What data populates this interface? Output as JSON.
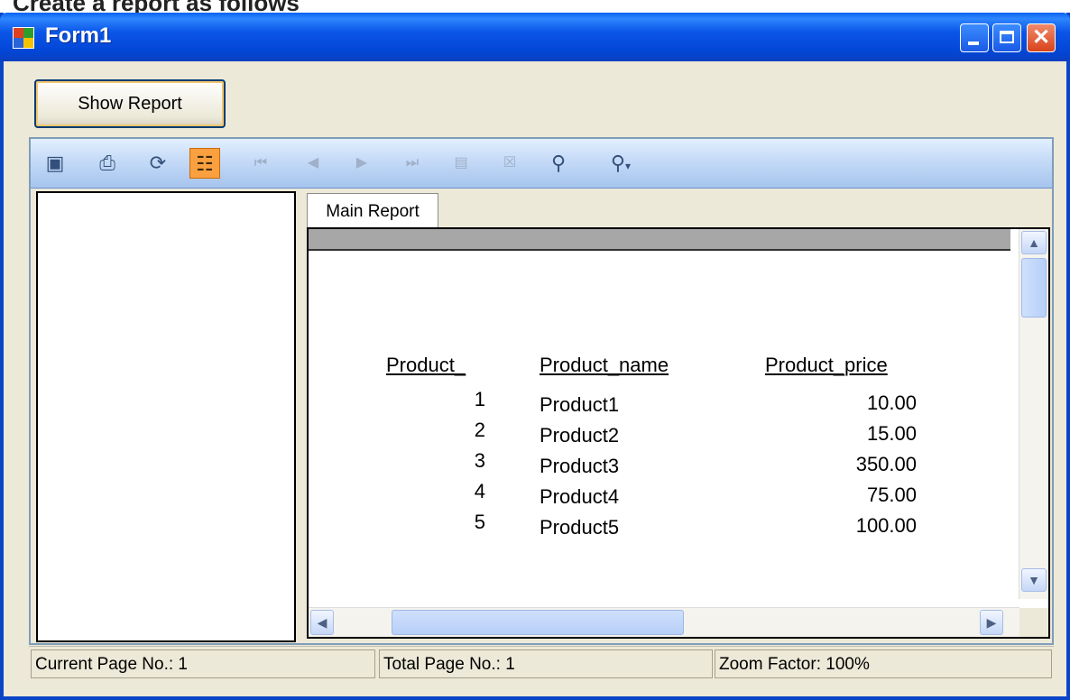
{
  "window": {
    "title": "Form1"
  },
  "partial_caption": "Create a report as follows",
  "show_report_button": "Show Report",
  "toolbar": {
    "buttons": [
      {
        "icon": "export-icon",
        "enabled": true
      },
      {
        "icon": "print-icon",
        "enabled": true
      },
      {
        "icon": "refresh-icon",
        "enabled": true
      },
      {
        "icon": "toggle-group-tree-icon",
        "enabled": true,
        "active": true
      },
      {
        "icon": "first-page-icon",
        "enabled": false
      },
      {
        "icon": "previous-page-icon",
        "enabled": false
      },
      {
        "icon": "next-page-icon",
        "enabled": false
      },
      {
        "icon": "last-page-icon",
        "enabled": false
      },
      {
        "icon": "goto-page-icon",
        "enabled": false
      },
      {
        "icon": "close-current-view-icon",
        "enabled": false
      },
      {
        "icon": "find-text-icon",
        "enabled": true
      },
      {
        "icon": "zoom-icon",
        "enabled": true
      }
    ]
  },
  "tab": {
    "label": "Main Report"
  },
  "report": {
    "headers": [
      "Product_",
      "Product_name",
      "Product_price"
    ],
    "rows": [
      {
        "id": "1",
        "name": "Product1",
        "price": "10.00"
      },
      {
        "id": "2",
        "name": "Product2",
        "price": "15.00"
      },
      {
        "id": "3",
        "name": "Product3",
        "price": "350.00"
      },
      {
        "id": "4",
        "name": "Product4",
        "price": "75.00"
      },
      {
        "id": "5",
        "name": "Product5",
        "price": "100.00"
      }
    ]
  },
  "status": {
    "current_page": "Current Page No.: 1",
    "total_page": "Total Page No.: 1",
    "zoom": "Zoom Factor: 100%"
  },
  "colors": {
    "titlebar": "#0a55e8",
    "window_bg": "#ece9d8",
    "toolbar_active": "#fba040"
  }
}
